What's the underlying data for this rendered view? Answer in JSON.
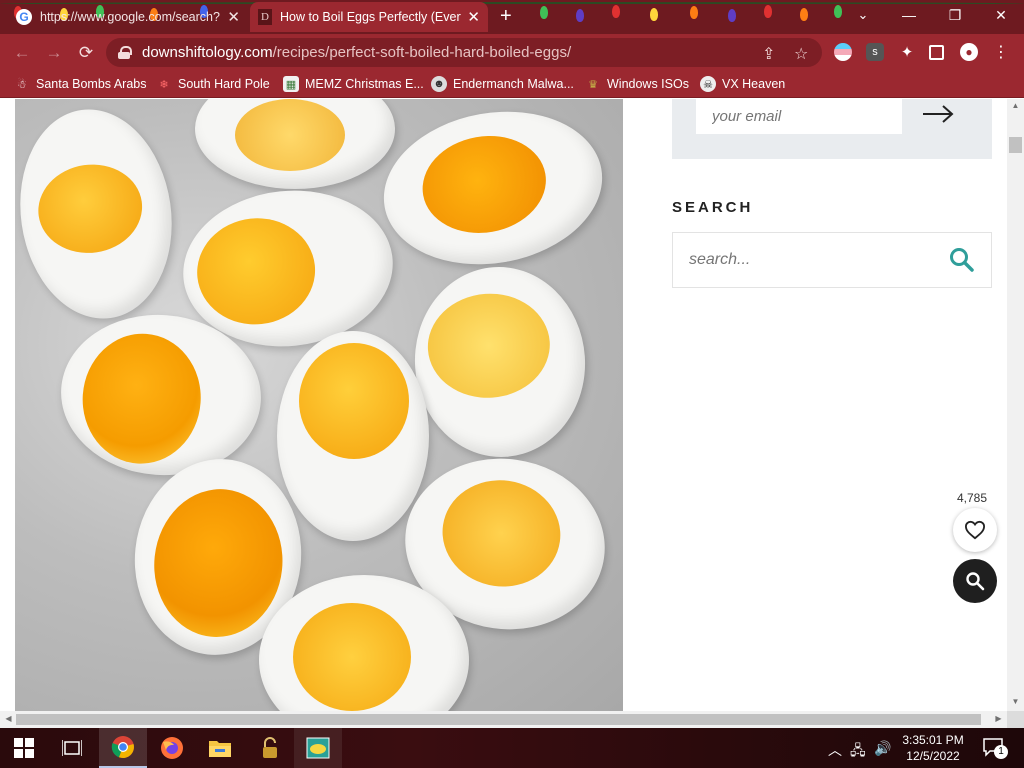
{
  "browser": {
    "tabs": [
      {
        "title": "https://www.google.com/search?",
        "icon": "google-icon",
        "active": false
      },
      {
        "title": "How to Boil Eggs Perfectly (Every",
        "icon": "downshiftology-favicon",
        "active": true
      }
    ],
    "url_domain": "downshiftology.com",
    "url_path": "/recipes/perfect-soft-boiled-hard-boiled-eggs/",
    "bookmarks": [
      {
        "label": "Santa Bombs Arabs",
        "icon": "santa-icon"
      },
      {
        "label": "South Hard Pole",
        "icon": "snowflake-icon"
      },
      {
        "label": "MEMZ Christmas E...",
        "icon": "memz-icon"
      },
      {
        "label": "Endermanch Malwa...",
        "icon": "endermanch-icon"
      },
      {
        "label": "Windows ISOs",
        "icon": "windows-iso-icon"
      },
      {
        "label": "VX Heaven",
        "icon": "vx-heaven-icon"
      }
    ]
  },
  "page": {
    "newsletter": {
      "email_placeholder": "your email"
    },
    "search": {
      "heading": "SEARCH",
      "placeholder": "search..."
    },
    "like_count": "4,785"
  },
  "taskbar": {
    "time": "3:35:01 PM",
    "date": "12/5/2022",
    "notification_count": "1"
  },
  "colors": {
    "title_bar": "#6e1a20",
    "toolbar": "#9b2830",
    "search_accent": "#2f9e9a",
    "taskbar": "#2a0a0c"
  }
}
